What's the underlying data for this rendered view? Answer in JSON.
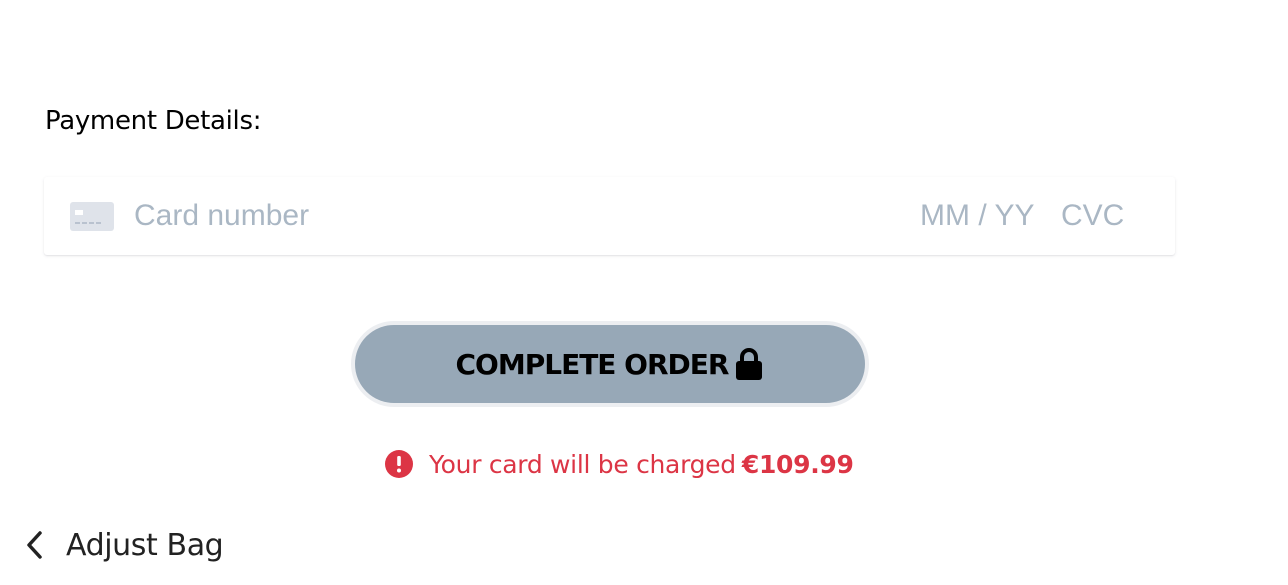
{
  "payment": {
    "section_label": "Payment Details:",
    "card_number_placeholder": "Card number",
    "expiry_placeholder": "MM / YY",
    "cvc_placeholder": "CVC"
  },
  "order": {
    "complete_label": "COMPLETE ORDER",
    "charge_text": "Your card will be charged",
    "charge_amount": "€109.99"
  },
  "navigation": {
    "back_label": "Adjust Bag"
  },
  "colors": {
    "button_bg": "#97a8b7",
    "alert": "#dc3545",
    "placeholder": "#aab7c4"
  }
}
